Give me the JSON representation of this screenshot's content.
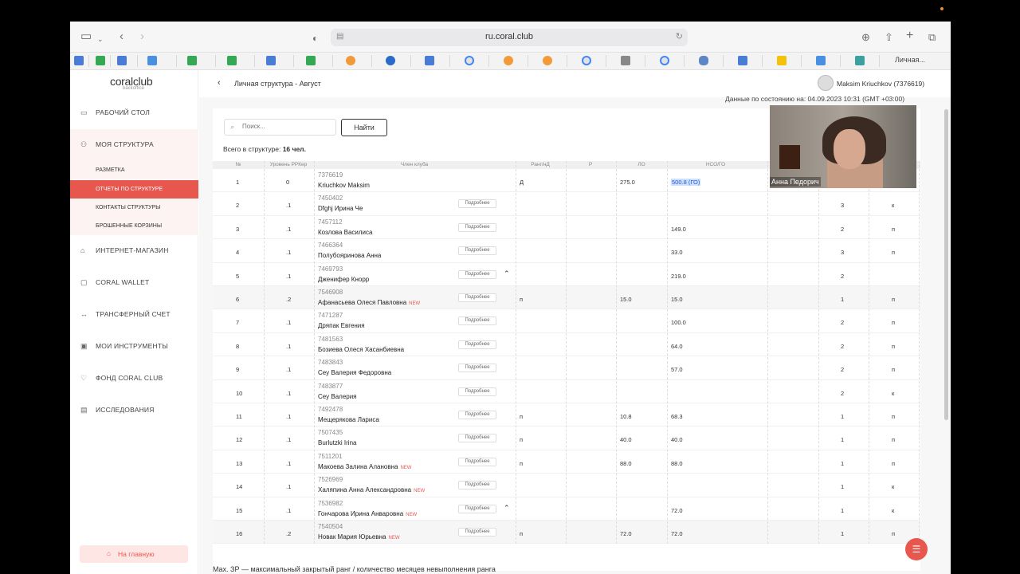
{
  "browser": {
    "url": "ru.coral.club",
    "bookmark_last": "Личная..."
  },
  "sidebar": {
    "logo": "coralclub",
    "logo_sub": "backoffice",
    "items": [
      {
        "label": "РАБОЧИЙ СТОЛ",
        "icon": "desktop-icon"
      },
      {
        "label": "МОЯ СТРУКТУРА",
        "icon": "people-icon"
      },
      {
        "label": "ИНТЕРНЕТ-МАГАЗИН",
        "icon": "bag-icon"
      },
      {
        "label": "CORAL WALLET",
        "icon": "wallet-icon"
      },
      {
        "label": "ТРАНСФЕРНЫЙ СЧЕТ",
        "icon": "transfer-icon"
      },
      {
        "label": "МОИ ИНСТРУМЕНТЫ",
        "icon": "tools-icon"
      },
      {
        "label": "ФОНД CORAL CLUB",
        "icon": "heart-icon"
      },
      {
        "label": "ИССЛЕДОВАНИЯ",
        "icon": "clipboard-icon"
      }
    ],
    "sub_items": [
      "РАЗМЕТКА",
      "ОТЧЕТЫ ПО СТРУКТУРЕ",
      "КОНТАКТЫ СТРУКТУРЫ",
      "БРОШЕННЫЕ КОРЗИНЫ"
    ],
    "home_label": "На главную"
  },
  "header": {
    "title": "Личная структура - Август",
    "user": "Maksim Kriuchkov (7376619)",
    "date_note": "Данные по состоянию на: 04.09.2023 10:31 (GMT +03:00)"
  },
  "search": {
    "placeholder": "Поиск...",
    "button": "Найти"
  },
  "total": {
    "label": "Всего в структуре:",
    "value": "16 чел."
  },
  "table": {
    "headers": [
      "№",
      "Уровень РРКер",
      "Член клуба",
      "Ранг/нД",
      "Р",
      "ЛО",
      "НСО/ГО"
    ],
    "more_label": "Подробнее",
    "new_label": "NEW",
    "rows": [
      {
        "n": "1",
        "lvl": "0",
        "id": "7376619",
        "name": "Kriuchkov Maksim",
        "rank": "Д",
        "lo": "275.0",
        "nso": "500.8 (ГО)",
        "c1": "",
        "c2": "",
        "more": false
      },
      {
        "n": "2",
        "lvl": ".1",
        "id": "7450402",
        "name": "Dfghj Ирина Че",
        "rank": "",
        "lo": "",
        "nso": "",
        "c1": "3",
        "c2": "к",
        "more": true
      },
      {
        "n": "3",
        "lvl": ".1",
        "id": "7457112",
        "name": "Козлова Василиса",
        "rank": "",
        "lo": "",
        "nso": "149.0",
        "c1": "2",
        "c2": "п",
        "more": true
      },
      {
        "n": "4",
        "lvl": ".1",
        "id": "7466364",
        "name": "Полубояринова Анна",
        "rank": "",
        "lo": "",
        "nso": "33.0",
        "c1": "3",
        "c2": "п",
        "more": true
      },
      {
        "n": "5",
        "lvl": ".1",
        "id": "7469793",
        "name": "Дженифер Кнорр",
        "rank": "",
        "lo": "",
        "nso": "219.0",
        "c1": "2",
        "c2": "",
        "more": true,
        "caret": true
      },
      {
        "n": "6",
        "lvl": ".2",
        "id": "7546908",
        "name": "Афанасьева Олеся Павловна",
        "rank": "п",
        "lo": "15.0",
        "nso": "15.0",
        "c1": "1",
        "c2": "п",
        "more": true,
        "new": true,
        "shade": true
      },
      {
        "n": "7",
        "lvl": ".1",
        "id": "7471287",
        "name": "Дряпак Евгения",
        "rank": "",
        "lo": "",
        "nso": "100.0",
        "c1": "2",
        "c2": "п",
        "more": true
      },
      {
        "n": "8",
        "lvl": ".1",
        "id": "7481563",
        "name": "Бозиева Олеся Хасанбиевна",
        "rank": "",
        "lo": "",
        "nso": "64.0",
        "c1": "2",
        "c2": "п",
        "more": true
      },
      {
        "n": "9",
        "lvl": ".1",
        "id": "7483843",
        "name": "Сеу Валерия Федоровна",
        "rank": "",
        "lo": "",
        "nso": "57.0",
        "c1": "2",
        "c2": "п",
        "more": true
      },
      {
        "n": "10",
        "lvl": ".1",
        "id": "7483877",
        "name": "Сеу Валерия",
        "rank": "",
        "lo": "",
        "nso": "",
        "c1": "2",
        "c2": "к",
        "more": true
      },
      {
        "n": "11",
        "lvl": ".1",
        "id": "7492478",
        "name": "Мещерякова Лариса",
        "rank": "п",
        "lo": "10.8",
        "nso": "68.3",
        "c1": "1",
        "c2": "п",
        "more": true
      },
      {
        "n": "12",
        "lvl": ".1",
        "id": "7507435",
        "name": "Burlutzki Irina",
        "rank": "п",
        "lo": "40.0",
        "nso": "40.0",
        "c1": "1",
        "c2": "п",
        "more": true
      },
      {
        "n": "13",
        "lvl": ".1",
        "id": "7511201",
        "name": "Макоева Залина Алановна",
        "rank": "п",
        "lo": "88.0",
        "nso": "88.0",
        "c1": "1",
        "c2": "п",
        "more": true,
        "new": true
      },
      {
        "n": "14",
        "lvl": ".1",
        "id": "7526969",
        "name": "Халяпина Анна Александровна",
        "rank": "",
        "lo": "",
        "nso": "",
        "c1": "1",
        "c2": "к",
        "more": true,
        "new": true
      },
      {
        "n": "15",
        "lvl": ".1",
        "id": "7536982",
        "name": "Гончарова Ирина Анваровна",
        "rank": "",
        "lo": "",
        "nso": "72.0",
        "c1": "1",
        "c2": "к",
        "more": true,
        "new": true,
        "caret": true
      },
      {
        "n": "16",
        "lvl": ".2",
        "id": "7540504",
        "name": "Новак Мария Юрьевна",
        "rank": "п",
        "lo": "72.0",
        "nso": "72.0",
        "c1": "1",
        "c2": "п",
        "more": true,
        "new": true,
        "shade": true
      }
    ]
  },
  "footer_note": "Max. ЗР — максимальный закрытый ранг / количество месяцев невыполнения ранга",
  "webcam": {
    "name": "Анна Педорич"
  }
}
